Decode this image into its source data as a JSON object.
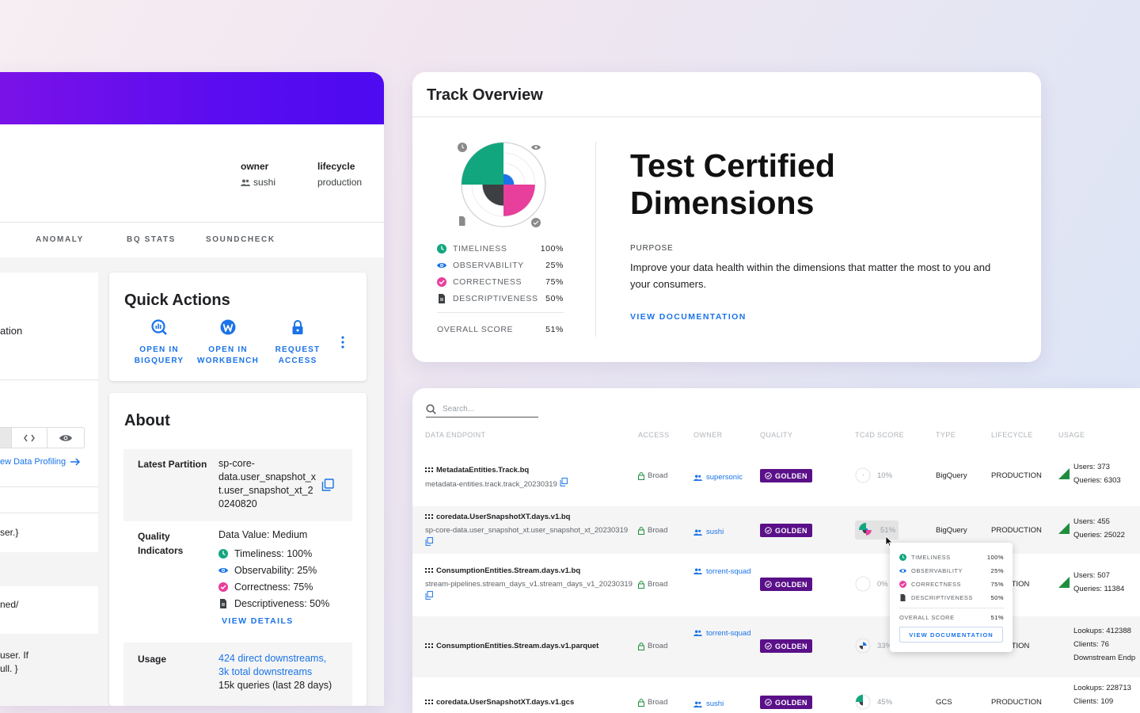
{
  "colors": {
    "brand_purple": "#5a0cf0",
    "link_blue": "#1a73e8",
    "timeliness": "#12a67f",
    "observability": "#1a73e8",
    "correctness": "#e83e9c",
    "descriptiveness": "#3c4043",
    "golden_badge": "#5a1088"
  },
  "detail": {
    "meta": [
      {
        "label": "owner",
        "value": "sushi",
        "icon": "team-icon"
      },
      {
        "label": "lifecycle",
        "value": "production"
      }
    ],
    "tabs": [
      "ANOMALY",
      "BQ STATS",
      "SOUNDCHECK"
    ],
    "stub": {
      "text_1": "ation",
      "profiling_link": "ew Data Profiling",
      "text_2": "ser.}",
      "text_3": "ned/",
      "text_4a": "user. If",
      "text_4b": "ull. }"
    },
    "quick_actions": {
      "title": "Quick Actions",
      "actions": [
        {
          "line1": "OPEN IN",
          "line2": "BIGQUERY",
          "icon": "bigquery-icon"
        },
        {
          "line1": "OPEN IN",
          "line2": "WORKBENCH",
          "icon": "workbench-icon"
        },
        {
          "line1": "REQUEST",
          "line2": "ACCESS",
          "icon": "lock-icon"
        }
      ]
    },
    "about": {
      "title": "About",
      "latest_partition_label": "Latest Partition",
      "latest_partition_lines": [
        "sp-core-",
        "data.user_snapshot_x",
        "t.user_snapshot_xt_2",
        "0240820"
      ],
      "quality_label_1": "Quality",
      "quality_label_2": "Indicators",
      "data_value": "Data Value: Medium",
      "indicators": [
        {
          "text": "Timeliness: 100%"
        },
        {
          "text": "Observability: 25%"
        },
        {
          "text": "Correctness: 75%"
        },
        {
          "text": "Descriptiveness: 50%"
        }
      ],
      "view_details": "VIEW DETAILS",
      "usage_label": "Usage",
      "usage_link_1": "424 direct downstreams,",
      "usage_link_2": "3k total downstreams",
      "usage_text": "15k queries (last 28 days)"
    }
  },
  "track": {
    "title": "Track Overview",
    "scores": [
      {
        "name": "TIMELINESS",
        "value": "100%",
        "fraction": 1.0
      },
      {
        "name": "OBSERVABILITY",
        "value": "25%",
        "fraction": 0.25
      },
      {
        "name": "CORRECTNESS",
        "value": "75%",
        "fraction": 0.75
      },
      {
        "name": "DESCRIPTIVENESS",
        "value": "50%",
        "fraction": 0.5
      }
    ],
    "overall_label": "OVERALL SCORE",
    "overall_value": "51%",
    "heading_line1": "Test Certified",
    "heading_line2": "Dimensions",
    "purpose_label": "PURPOSE",
    "purpose_text": "Improve your data health within the dimensions that matter the most to you and your consumers.",
    "view_documentation": "VIEW DOCUMENTATION"
  },
  "table": {
    "search_placeholder": "Search...",
    "headers": [
      "DATA ENDPOINT",
      "ACCESS",
      "OWNER",
      "QUALITY",
      "TC4D SCORE",
      "TYPE",
      "LIFECYCLE",
      "USAGE"
    ],
    "rows": [
      {
        "name": "MetadataEntities.Track.bq",
        "path": "metadata-entities.track.track_20230319",
        "access": "Broad",
        "owner": "supersonic",
        "quality": "GOLDEN",
        "score": "10%",
        "type": "BigQuery",
        "lifecycle": "PRODUCTION",
        "usage_1": "Users: 373",
        "usage_2": "Queries: 6303",
        "usage_3": ""
      },
      {
        "name": "coredata.UserSnapshotXT.days.v1.bq",
        "path": "sp-core-data.user_snapshot_xt.user_snapshot_xt_20230319",
        "access": "Broad",
        "owner": "sushi",
        "quality": "GOLDEN",
        "score": "51%",
        "type": "BigQuery",
        "lifecycle": "PRODUCTION",
        "usage_1": "Users: 455",
        "usage_2": "Queries: 25022",
        "usage_3": ""
      },
      {
        "name": "ConsumptionEntities.Stream.days.v1.bq",
        "path": "stream-pipelines.stream_days_v1.stream_days_v1_20230319",
        "access": "Broad",
        "owner": "torrent-squad",
        "quality": "GOLDEN",
        "score": "0%",
        "type": "",
        "lifecycle": "UCTION",
        "usage_1": "Users: 507",
        "usage_2": "Queries: 11384",
        "usage_3": ""
      },
      {
        "name": "ConsumptionEntities.Stream.days.v1.parquet",
        "path": "",
        "access": "Broad",
        "owner": "torrent-squad",
        "quality": "GOLDEN",
        "score": "33%",
        "type": "",
        "lifecycle": "UCTION",
        "usage_1": "Lookups: 412388",
        "usage_2": "Clients: 76",
        "usage_3": "Downstream Endp"
      },
      {
        "name": "coredata.UserSnapshotXT.days.v1.gcs",
        "path": "",
        "access": "Broad",
        "owner": "sushi",
        "quality": "GOLDEN",
        "score": "45%",
        "type": "GCS",
        "lifecycle": "PRODUCTION",
        "usage_1": "Lookups: 228713",
        "usage_2": "Clients: 109",
        "usage_3": ""
      }
    ],
    "popup": {
      "scores": [
        {
          "name": "TIMELINESS",
          "value": "100%"
        },
        {
          "name": "OBSERVABILITY",
          "value": "25%"
        },
        {
          "name": "CORRECTNESS",
          "value": "75%"
        },
        {
          "name": "DESCRIPTIVENESS",
          "value": "50%"
        }
      ],
      "overall_label": "OVERALL SCORE",
      "overall_value": "51%",
      "button": "VIEW DOCUMENTATION"
    }
  }
}
